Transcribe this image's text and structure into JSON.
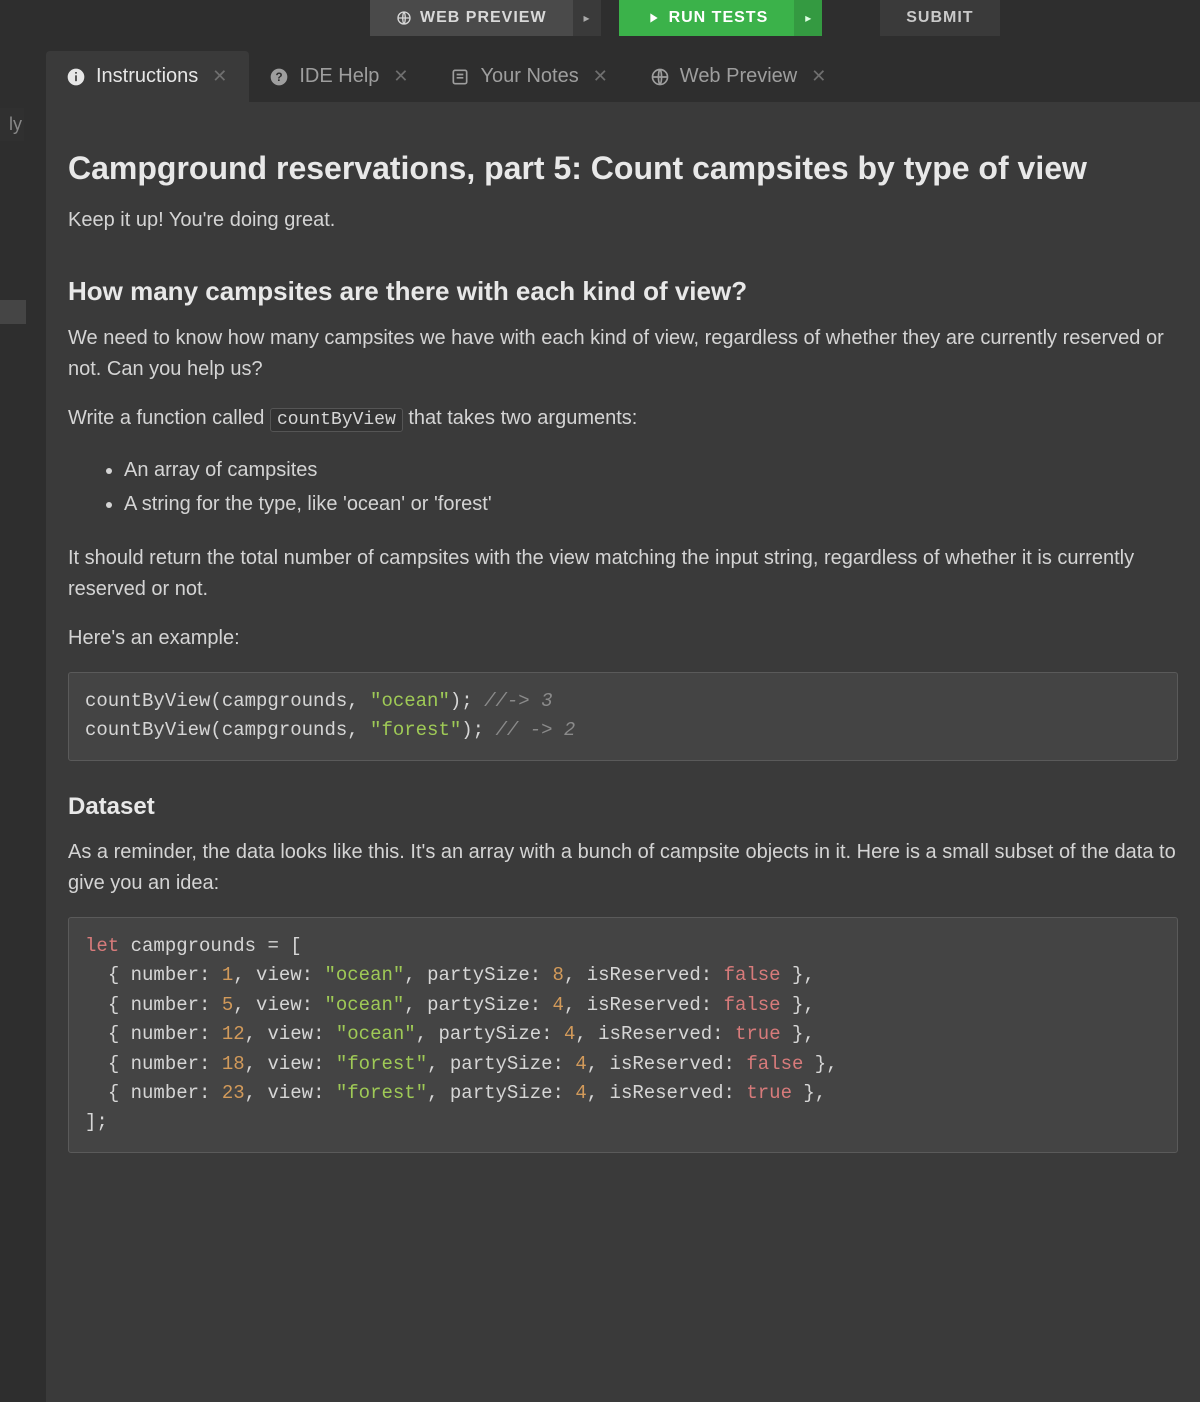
{
  "topbar": {
    "web_preview": "WEB PREVIEW",
    "run_tests": "RUN TESTS",
    "submit": "SUBMIT"
  },
  "left_stub": "ly",
  "tabs": [
    {
      "label": "Instructions",
      "icon": "info-circle-icon",
      "active": true
    },
    {
      "label": "IDE Help",
      "icon": "question-circle-icon",
      "active": false
    },
    {
      "label": "Your Notes",
      "icon": "note-icon",
      "active": false
    },
    {
      "label": "Web Preview",
      "icon": "globe-icon",
      "active": false
    }
  ],
  "instructions": {
    "title": "Campground reservations, part 5: Count campsites by type of view",
    "intro": "Keep it up! You're doing great.",
    "subheading": "How many campsites are there with each kind of view?",
    "para1": "We need to know how many campsites we have with each kind of view, regardless of whether they are currently reserved or not. Can you help us?",
    "para2_pre": "Write a function called ",
    "para2_code": "countByView",
    "para2_post": " that takes two arguments:",
    "bullets": [
      "An array of campsites",
      "A string for the type, like 'ocean' or 'forest'"
    ],
    "para3": "It should return the total number of campsites with the view matching the input string, regardless of whether it is currently reserved or not.",
    "para4": "Here's an example:",
    "example_code": {
      "line1_a": "countByView(campgrounds, ",
      "line1_str": "\"ocean\"",
      "line1_b": "); ",
      "line1_com": "//-> 3",
      "line2_a": "countByView(campgrounds, ",
      "line2_str": "\"forest\"",
      "line2_b": "); ",
      "line2_com": "// -> 2"
    },
    "dataset_heading": "Dataset",
    "dataset_para": "As a reminder, the data looks like this. It's an array with a bunch of campsite objects in it. Here is a small subset of the data to give you an idea:",
    "dataset_code": {
      "kw_let": "let",
      "var": " campgrounds = [",
      "rows": [
        {
          "number": "1",
          "view": "\"ocean\"",
          "partySize": "8",
          "isReserved": "false"
        },
        {
          "number": "5",
          "view": "\"ocean\"",
          "partySize": "4",
          "isReserved": "false"
        },
        {
          "number": "12",
          "view": "\"ocean\"",
          "partySize": "4",
          "isReserved": "true"
        },
        {
          "number": "18",
          "view": "\"forest\"",
          "partySize": "4",
          "isReserved": "false"
        },
        {
          "number": "23",
          "view": "\"forest\"",
          "partySize": "4",
          "isReserved": "true"
        }
      ],
      "close": "];"
    }
  }
}
